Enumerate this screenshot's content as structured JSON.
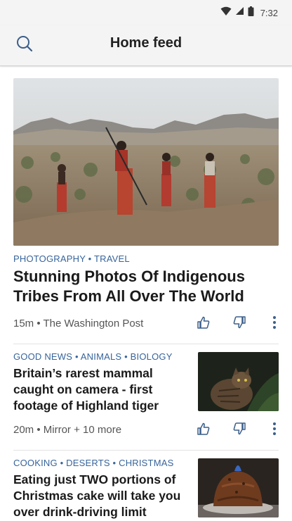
{
  "status_bar": {
    "time": "7:32",
    "icons": [
      "wifi-icon",
      "signal-icon",
      "battery-icon"
    ]
  },
  "header": {
    "title": "Home feed",
    "search_icon": "search-icon"
  },
  "feed": {
    "hero": {
      "tags": "PHOTOGRAPHY • TRAVEL",
      "title": "Stunning Photos Of Indigenous Tribes From All Over The World",
      "meta": "15m • The Washington Post"
    },
    "items": [
      {
        "tags": "GOOD NEWS • ANIMALS • BIOLOGY",
        "title": "Britain’s rarest mammal caught on camera - first footage of Highland tiger",
        "meta": "20m • Mirror + 10 more"
      },
      {
        "tags": "COOKING • DESERTS • CHRISTMAS",
        "title": "Eating just TWO portions of Christmas cake will take you over drink-driving limit"
      }
    ],
    "action_icons": [
      "thumbs-up-icon",
      "thumbs-down-icon",
      "more-vertical-icon"
    ]
  },
  "colors": {
    "tag": "#37649b",
    "header_bg": "#f4f4f4",
    "icon": "#3b5f8a"
  }
}
